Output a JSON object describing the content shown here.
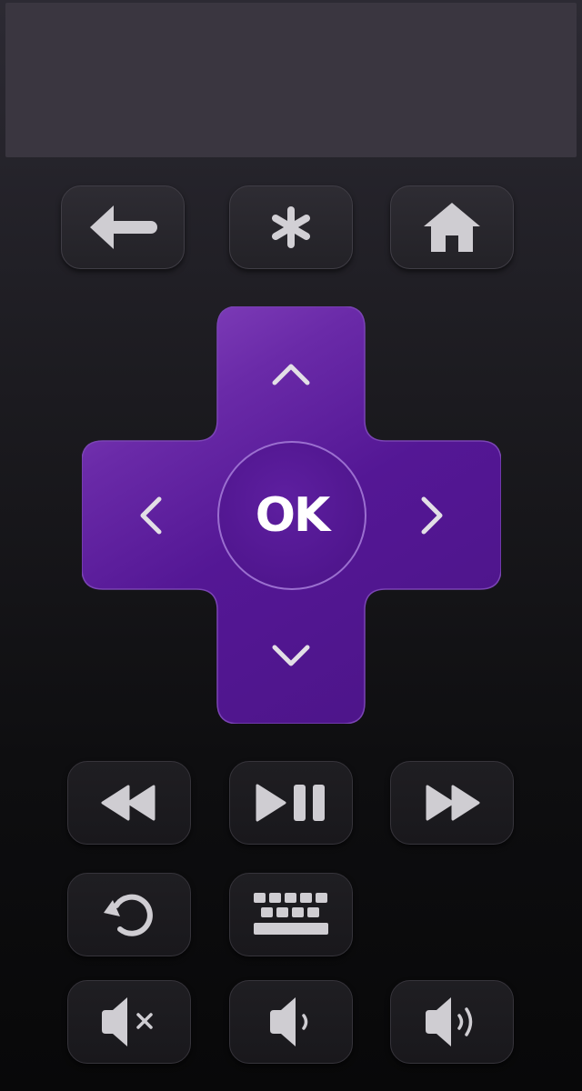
{
  "remote": {
    "top_row": [
      {
        "name": "back-button",
        "icon": "back-arrow-icon"
      },
      {
        "name": "options-button",
        "icon": "asterisk-icon"
      },
      {
        "name": "home-button",
        "icon": "home-icon"
      }
    ],
    "dpad": {
      "ok_label": "OK",
      "up_icon": "chevron-up-icon",
      "down_icon": "chevron-down-icon",
      "left_icon": "chevron-left-icon",
      "right_icon": "chevron-right-icon"
    },
    "media_row": [
      {
        "name": "rewind-button",
        "icon": "rewind-icon"
      },
      {
        "name": "play-pause-button",
        "icon": "play-pause-icon"
      },
      {
        "name": "fast-forward-button",
        "icon": "fast-forward-icon"
      }
    ],
    "utility_row": [
      {
        "name": "instant-replay-button",
        "icon": "replay-icon"
      },
      {
        "name": "keyboard-button",
        "icon": "keyboard-icon"
      }
    ],
    "volume_row": [
      {
        "name": "mute-button",
        "icon": "volume-mute-icon"
      },
      {
        "name": "volume-down-button",
        "icon": "volume-down-icon"
      },
      {
        "name": "volume-up-button",
        "icon": "volume-up-icon"
      }
    ]
  },
  "colors": {
    "accent_purple": "#5b1a9a",
    "icon_gray": "#c9c7cc",
    "button_bg": "#2a2930"
  }
}
